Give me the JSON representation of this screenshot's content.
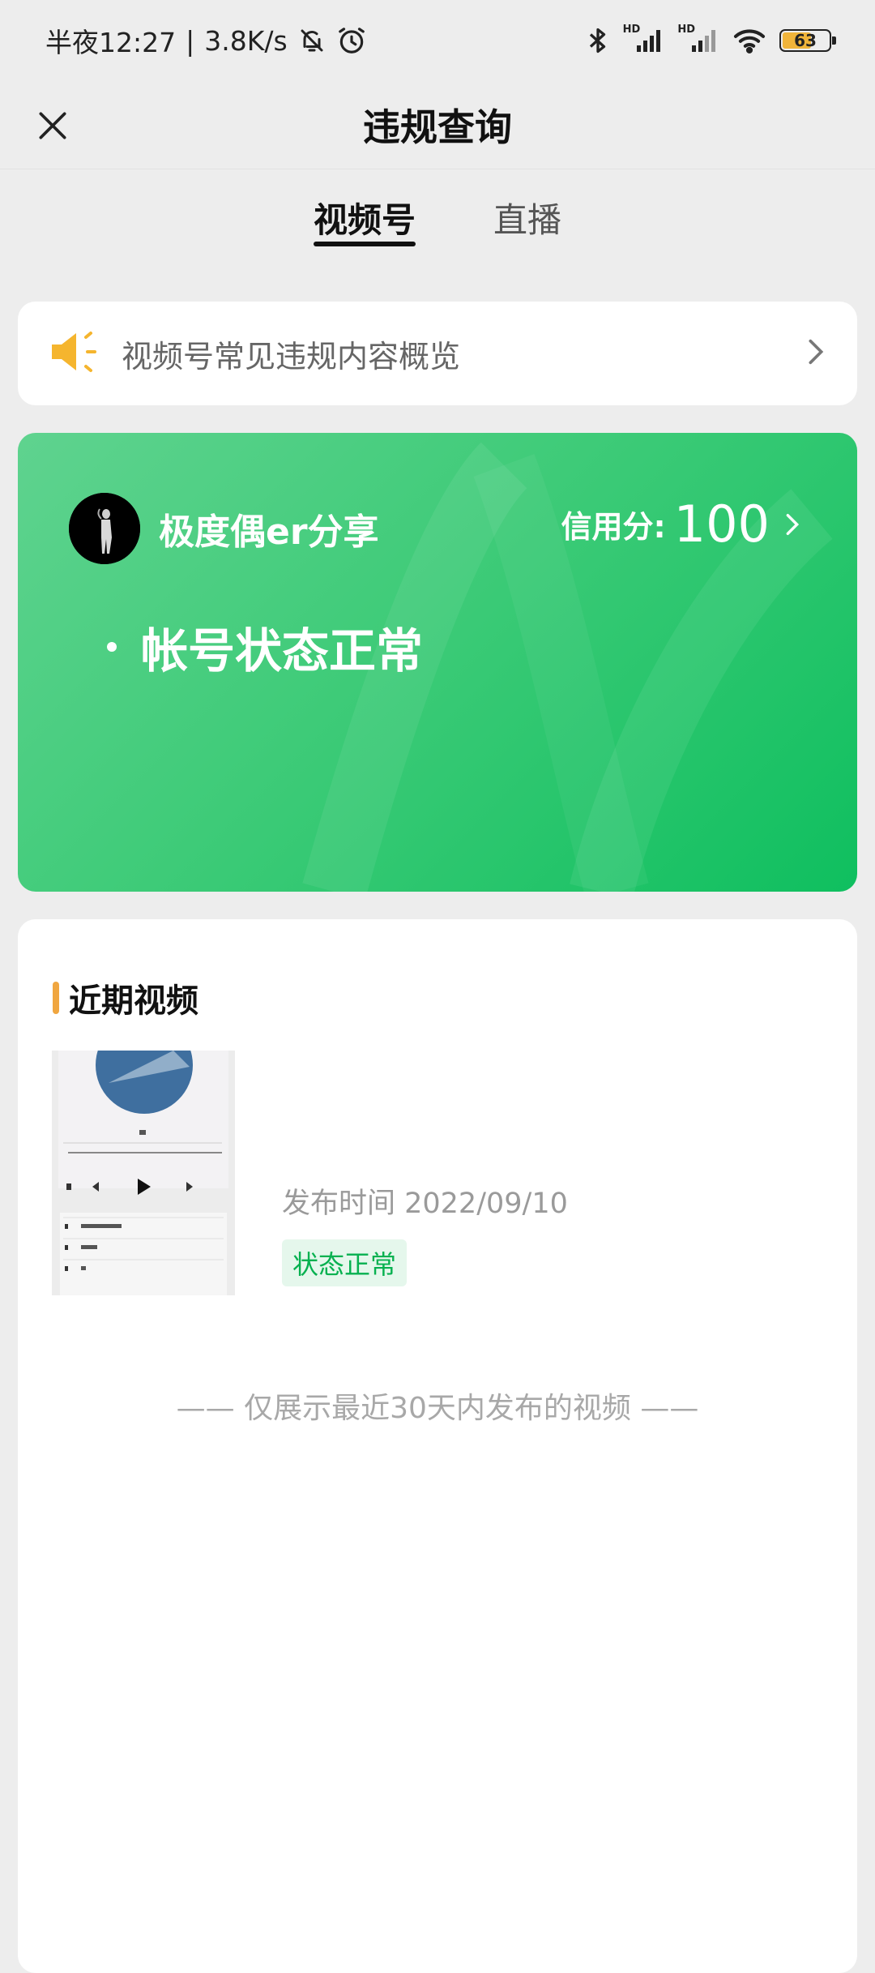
{
  "status_bar": {
    "time": "半夜12:27",
    "speed": "3.8K/s",
    "signal1_label": "HD",
    "signal2_label": "HD",
    "battery": "63",
    "battery_level": 63
  },
  "nav": {
    "title": "违规查询"
  },
  "tabs": [
    {
      "label": "视频号",
      "active": true
    },
    {
      "label": "直播",
      "active": false
    }
  ],
  "notice": {
    "text": "视频号常见违规内容概览"
  },
  "account": {
    "name": "极度偶er分享",
    "credit_label": "信用分:",
    "credit_score": "100",
    "status": "帐号状态正常"
  },
  "recent": {
    "title": "近期视频",
    "videos": [
      {
        "publish_time": "发布时间 2022/09/10",
        "status": "状态正常"
      }
    ],
    "footnote": "—— 仅展示最近30天内发布的视频 ——"
  },
  "colors": {
    "brand_green": "#07c160",
    "accent_orange": "#f0a640",
    "badge_bg": "#e5f7ec"
  }
}
